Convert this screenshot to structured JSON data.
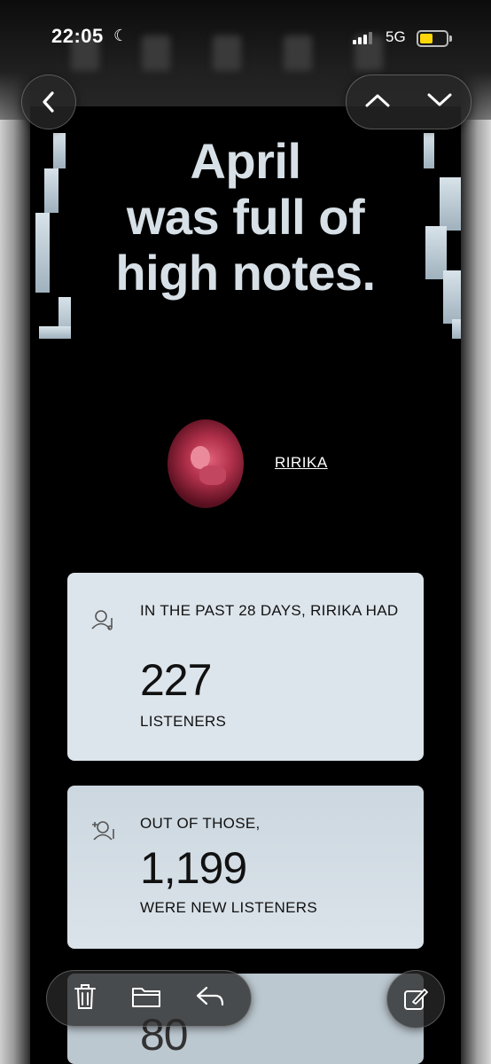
{
  "status_bar": {
    "time": "22:05",
    "network": "5G"
  },
  "headline": {
    "line1": "April",
    "line2": "was full of",
    "line3": "high notes."
  },
  "artist": {
    "name": "RIRIKA"
  },
  "cards": [
    {
      "pre": "IN THE PAST 28 DAYS, RIRIKA HAD",
      "value": "227",
      "post": "LISTENERS"
    },
    {
      "pre": "OUT OF THOSE,",
      "value": "1,199",
      "post": "WERE NEW LISTENERS"
    },
    {
      "value": "80"
    }
  ],
  "icons": {
    "back": "chevron-left-icon",
    "up": "chevron-up-icon",
    "down": "chevron-down-icon",
    "listeners": "listener-icon",
    "new_listeners": "new-listener-icon",
    "trash": "trash-icon",
    "folder": "folder-icon",
    "reply": "reply-icon",
    "compose": "compose-icon"
  },
  "colors": {
    "card": "#dde5ec",
    "headline": "#d7e0e6",
    "battery": "#ffd60a"
  }
}
